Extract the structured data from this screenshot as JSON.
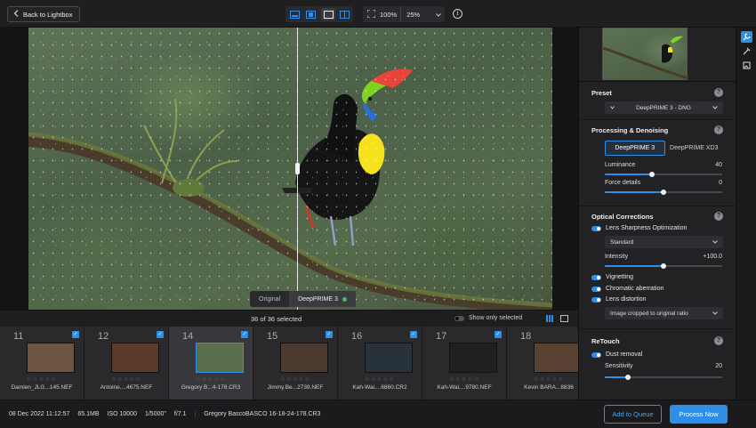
{
  "topbar": {
    "back_label": "Back to Lightbox",
    "zoom_fit": "100%",
    "zoom_level": "25%"
  },
  "viewer": {
    "compare_original": "Original",
    "compare_processed": "DeepPRIME 3"
  },
  "filmstrip": {
    "count_label": "36 of 36 selected",
    "show_only_selected": "Show only selected",
    "items": [
      {
        "num": "11",
        "name": "Damien_JLG...145.NEF",
        "stars": "☆☆☆☆☆",
        "color": "#6b5540",
        "selected": false
      },
      {
        "num": "12",
        "name": "Antoine....4675.NEF",
        "stars": "☆☆☆☆☆",
        "color": "#5a3a2a",
        "selected": false
      },
      {
        "num": "14",
        "name": "Gregory B...4-178.CR3",
        "stars": "☆☆☆☆☆",
        "color": "#5a6d4d",
        "selected": true
      },
      {
        "num": "15",
        "name": "Jimmy.Be...2739.NEF",
        "stars": "☆☆☆☆☆",
        "color": "#4a3a30",
        "selected": false
      },
      {
        "num": "16",
        "name": "Kah-Wai....6860.CR2",
        "stars": "☆☆☆☆☆",
        "color": "#28323a",
        "selected": false
      },
      {
        "num": "17",
        "name": "Kah-Wai....9780.NEF",
        "stars": "☆☆☆☆☆",
        "color": "#202020",
        "selected": false
      },
      {
        "num": "18",
        "name": "Kevin BARA...8836",
        "stars": "☆☆☆☆☆",
        "color": "#5a4030",
        "selected": false
      }
    ]
  },
  "status": {
    "date": "08 Dec 2022 11:12:57",
    "size": "65.1MB",
    "iso": "ISO 10000",
    "shutter": "1/5000\"",
    "aperture": "f/7.1",
    "filename": "Gregory BascoBASCO 16-18-24-178.CR3"
  },
  "actions": {
    "add_queue": "Add to Queue",
    "process_now": "Process Now"
  },
  "panel": {
    "preset": {
      "title": "Preset",
      "value": "DeepPRIME 3 - DNG"
    },
    "denoise": {
      "title": "Processing & Denoising",
      "modes": [
        "DeepPRIME 3",
        "DeepPRIME XD3"
      ],
      "luminance_label": "Luminance",
      "luminance_value": "40",
      "luminance_fraction": 0.4,
      "force_label": "Force details",
      "force_value": "0",
      "force_fraction": 0.5
    },
    "optical": {
      "title": "Optical Corrections",
      "lens_sharpness": "Lens Sharpness Optimization",
      "sharpness_mode": "Standard",
      "intensity_label": "Intensity",
      "intensity_value": "+100.0",
      "intensity_fraction": 0.5,
      "vignetting": "Vignetting",
      "chromatic": "Chromatic aberration",
      "distortion": "Lens distortion",
      "distortion_mode": "Image cropped to original ratio"
    },
    "retouch": {
      "title": "ReTouch",
      "dust": "Dust removal",
      "sensitivity_label": "Sensitivity",
      "sensitivity_value": "20",
      "sensitivity_fraction": 0.2
    }
  },
  "colors": {
    "accent": "#2e8fe8",
    "panel_bg": "#222225",
    "toucan_bill": "#7ed320"
  }
}
